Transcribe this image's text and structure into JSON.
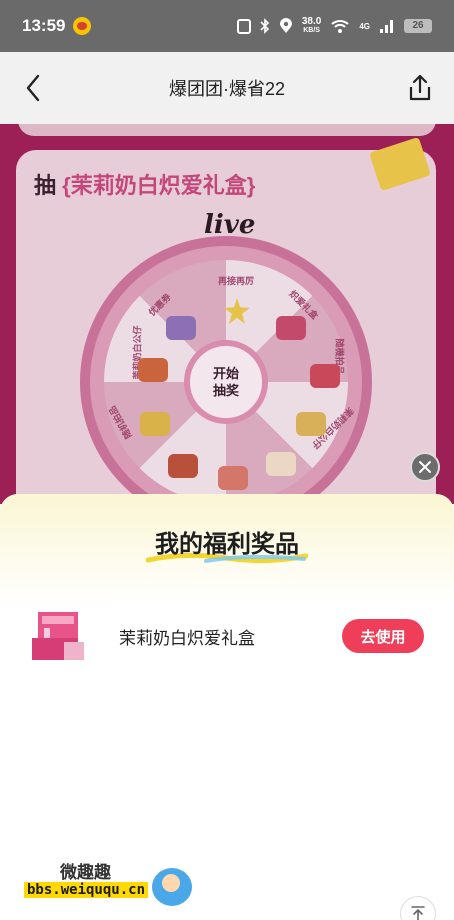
{
  "status_bar": {
    "time": "13:59",
    "speed_value": "38.0",
    "speed_unit": "KB/S",
    "network": "4G",
    "battery": "26"
  },
  "header": {
    "title": "爆团团·爆省22"
  },
  "background_page": {
    "card_title_prefix": "抽",
    "card_title_highlight": "{茉莉奶白炽爱礼盒}",
    "live_logo": "live",
    "wheel_center": "开始\n抽奖",
    "wheel_center_line1": "开始",
    "wheel_center_line2": "抽奖",
    "prizes": [
      "再接再厉",
      "炽爱礼盒",
      "随機拍品",
      "茉莉奶白公仔",
      "随机拍品",
      "茉莉奶白公仔",
      "随机拍品",
      "优惠券"
    ]
  },
  "sheet": {
    "title": "我的福利奖品",
    "reward": {
      "name": "茉莉奶白炽爱礼盒",
      "action_label": "去使用"
    }
  },
  "watermark": {
    "top": "微趣趣",
    "bottom": "bbs.weiququ.cn"
  },
  "colors": {
    "accent": "#ee3e5a",
    "overlay_bg": "#9c1f55",
    "status_bar": "#6a6a6a"
  }
}
